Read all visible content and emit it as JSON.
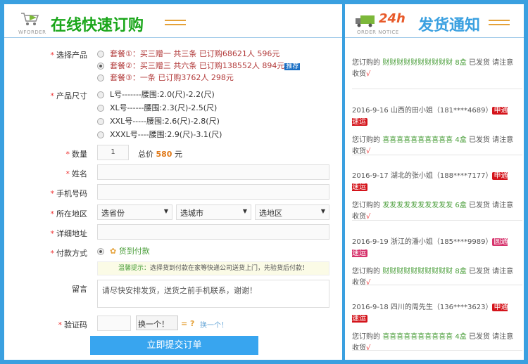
{
  "left_header": {
    "title": "在线快速订购",
    "logo_sub": "WFORDER"
  },
  "right_header": {
    "title": "发货通知",
    "badge_24h": "24h",
    "logo_sub": "ORDER NOTICE"
  },
  "form": {
    "product_label": "选择产品",
    "products": [
      {
        "text": "套餐①：买三赠一 共三条 已订购68621人 596元"
      },
      {
        "text": "套餐②：买三赠三 共六条 已订购138552人 894元",
        "tag": "推荐"
      },
      {
        "text": "套餐③：一条 已订购3762人 298元"
      }
    ],
    "size_label": "产品尺寸",
    "sizes": [
      "L号-------腰围:2.0(尺)-2.2(尺)",
      "XL号------腰围:2.3(尺)-2.5(尺)",
      "XXL号-----腰围:2.6(尺)-2.8(尺)",
      "XXXL号----腰围:2.9(尺)-3.1(尺)"
    ],
    "qty_label": "数量",
    "qty_value": "1",
    "total_label": "总价",
    "total_value": "580",
    "total_unit": "元",
    "name_label": "姓名",
    "phone_label": "手机号码",
    "region_label": "所在地区",
    "province": "选省份",
    "city": "选城市",
    "district": "选地区",
    "address_label": "详细地址",
    "pay_label": "付款方式",
    "pay_option": "货到付款",
    "tip_title": "温馨提示：",
    "tip_text": "选择货到付款在家等快递公司送货上门，先验货后付款！",
    "message_label": "留言",
    "message_value": "请尽快安排发货，送货之前手机联系，谢谢！",
    "captcha_label": "验证码",
    "captcha_img_alt": "换一个！",
    "captcha_eq": "= ?",
    "captcha_refresh": "换一个！",
    "submit": "立即提交订单"
  },
  "notices": [
    {
      "header": "",
      "product": "财财财财财财财财财财",
      "qty": "8盒",
      "status": "已发货 请注意",
      "tail": "收货",
      "check": "√"
    },
    {
      "header": "2016-9-16 山西的田小姐（181****4689）",
      "courier": "申通速运",
      "product": "喜喜喜喜喜喜喜喜喜喜",
      "qty": "4盒",
      "status": "已发货 请注意",
      "tail": "收货",
      "check": "√"
    },
    {
      "header": "2016-9-17 湖北的张小姐（188****7177）",
      "courier": "申通速运",
      "product": "发发发发发发发发发发",
      "qty": "6盒",
      "status": "已发货 请注意",
      "tail": "收货",
      "check": "√"
    },
    {
      "header": "2016-9-19 浙江的潘小姐（185****9989）",
      "courier": "圆通速运",
      "product": "财财财财财财财财财财",
      "qty": "8盒",
      "status": "已发货 请注意",
      "tail": "收货",
      "check": "√"
    },
    {
      "header": "2016-9-18 四川的周先生（136****3623）",
      "courier": "申通速运",
      "product": "喜喜喜喜喜喜喜喜喜喜",
      "qty": "4盒",
      "status": "已发货 请注意",
      "tail": "收货",
      "check": "√"
    }
  ],
  "prefix": "您订购的",
  "colors": {
    "border": "#3aa0e0",
    "button": "#38a5ef",
    "red_badge": "#d4141b",
    "pink_badge": "#d6336c"
  }
}
